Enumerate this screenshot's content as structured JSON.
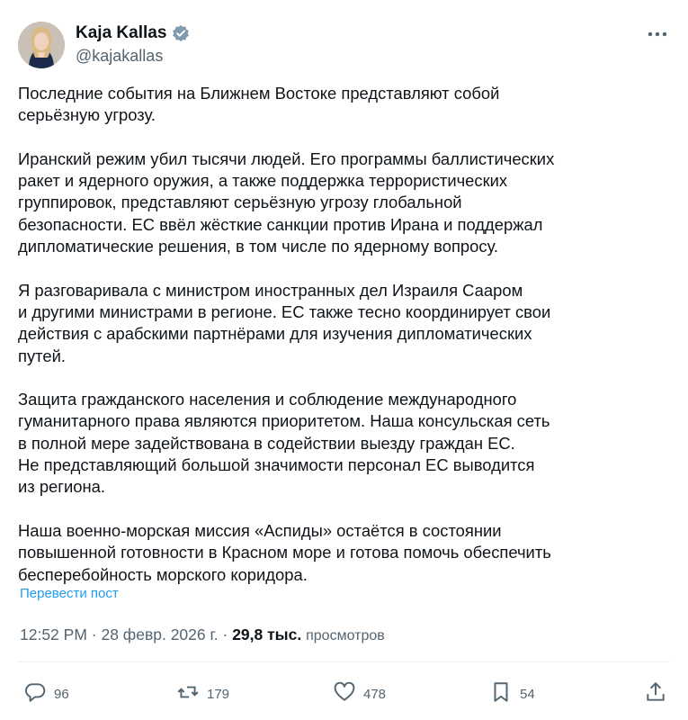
{
  "post": {
    "author": {
      "display_name": "Kaja Kallas",
      "handle": "@kajakallas",
      "verified_icon": "verified-badge-icon",
      "avatar": "profile photo"
    },
    "paragraphs": [
      "Последние события на Ближнем Востоке представляют собой\nсерьёзную угрозу.",
      "Иранский режим убил тысячи людей. Его программы баллистических\nракет и ядерного оружия, а также поддержка террористических\nгруппировок, представляют серьёзную угрозу глобальной\nбезопасности. ЕС ввёл жёсткие санкции против Ирана и поддержал\nдипломатические решения, в том числе по ядерному вопросу.",
      "Я разговаривала с министром иностранных дел Израиля Сааром\nи другими министрами в регионе. ЕС также тесно координирует свои\nдействия с арабскими партнёрами для изучения дипломатических\nпутей.",
      "Защита гражданского населения и соблюдение международного\nгуманитарного права являются приоритетом. Наша консульская сеть\nв полной мере задействована в содействии выезду граждан ЕС.\nНе представляющий большой значимости персонал ЕС выводится\nиз региона.",
      "Наша военно-морская миссия «Аспиды» остаётся в состоянии\nповышенной готовности в Красном море и готова помочь обеспечить\nбесперебойность морского коридора."
    ],
    "translate_label": "Перевести пост",
    "time": "12:52 PM",
    "separator": "·",
    "date": "28 февр. 2026 г.",
    "views_count": "29,8 тыс.",
    "views_label": "просмотров"
  },
  "actions": {
    "replies": {
      "icon": "reply-icon",
      "count": "96"
    },
    "reposts": {
      "icon": "repost-icon",
      "count": "179"
    },
    "likes": {
      "icon": "like-icon",
      "count": "478"
    },
    "bookmarks": {
      "icon": "bookmark-icon",
      "count": "54"
    },
    "share": {
      "icon": "share-icon"
    }
  },
  "colors": {
    "text": "#0f1419",
    "secondary": "#536471",
    "link": "#1d9bf0",
    "verified": "#829aab"
  }
}
